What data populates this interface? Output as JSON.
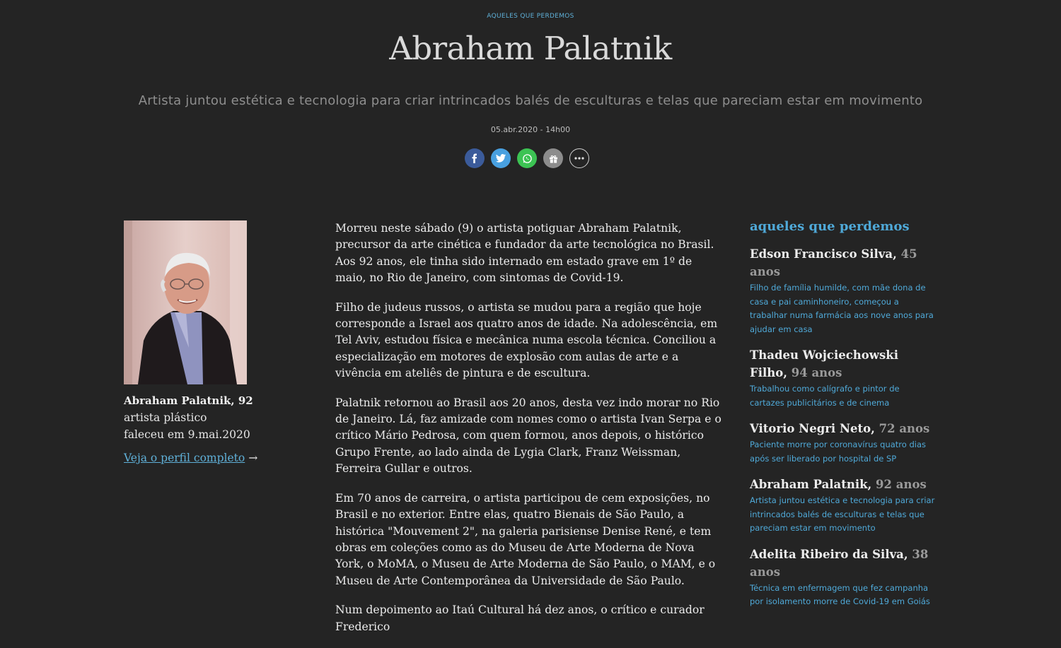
{
  "header": {
    "kicker": "AQUELES QUE PERDEMOS",
    "title": "Abraham Palatnik",
    "subtitle": "Artista juntou estética e tecnologia para criar intrincados balés de esculturas e telas que pareciam estar em movimento",
    "date": "05.abr.2020 - 14h00"
  },
  "share": {
    "icons": [
      "facebook-icon",
      "twitter-icon",
      "whatsapp-icon",
      "gift-icon",
      "more-icon"
    ]
  },
  "profile": {
    "name": "Abraham Palatnik, 92",
    "role": "artista plástico",
    "died": "faleceu em 9.mai.2020",
    "link": "Veja o perfil completo",
    "arrow": "→"
  },
  "article": {
    "paragraphs": [
      "Morreu neste sábado (9) o artista potiguar Abraham Palatnik, precursor da arte cinética e fundador da arte tecnológica no Brasil. Aos 92 anos, ele tinha sido internado em estado grave em 1º de maio, no Rio de Janeiro, com sintomas de Covid-19.",
      "Filho de judeus russos, o artista se mudou para a região que hoje corresponde a Israel aos quatro anos de idade. Na adolescência, em Tel Aviv, estudou física e mecânica numa escola técnica. Conciliou a especialização em motores de explosão com aulas de arte e a vivência em ateliês de pintura e de escultura.",
      "Palatnik retornou ao Brasil aos 20 anos, desta vez indo morar no Rio de Janeiro. Lá, faz amizade com nomes como o artista Ivan Serpa e o crítico Mário Pedrosa, com quem formou, anos depois, o histórico Grupo Frente, ao lado ainda de Lygia Clark, Franz Weissman, Ferreira Gullar e outros.",
      "Em 70 anos de carreira, o artista participou de cem exposições, no Brasil e no exterior. Entre elas, quatro Bienais de São Paulo, a histórica \"Mouvement 2\", na galeria parisiense Denise René, e tem obras em coleções como as do Museu de Arte Moderna de Nova York, o MoMA, o Museu de Arte Moderna de São Paulo, o MAM, e o Museu de Arte Contemporânea da Universidade de São Paulo.",
      "Num depoimento ao Itaú Cultural há dez anos, o crítico e curador Frederico"
    ]
  },
  "rail": {
    "title": "aqueles que perdemos",
    "items": [
      {
        "name": "Edson Francisco Silva,",
        "age": "45 anos",
        "desc": "Filho de família humilde, com mãe dona de casa e pai caminhoneiro, começou a trabalhar numa farmácia aos nove anos para ajudar em casa"
      },
      {
        "name": "Thadeu Wojciechowski Filho,",
        "age": "94 anos",
        "desc": "Trabalhou como calígrafo e pintor de cartazes publicitários e de cinema"
      },
      {
        "name": "Vitorio Negri Neto,",
        "age": "72 anos",
        "desc": "Paciente morre por coronavírus quatro dias após ser liberado por hospital de SP"
      },
      {
        "name": "Abraham Palatnik,",
        "age": "92 anos",
        "desc": "Artista juntou estética e tecnologia para criar intrincados balés de esculturas e telas que pareciam estar em movimento"
      },
      {
        "name": "Adelita Ribeiro da Silva,",
        "age": "38 anos",
        "desc": "Técnica em enfermagem que fez campanha por isolamento morre de Covid-19 em Goiás"
      }
    ]
  }
}
